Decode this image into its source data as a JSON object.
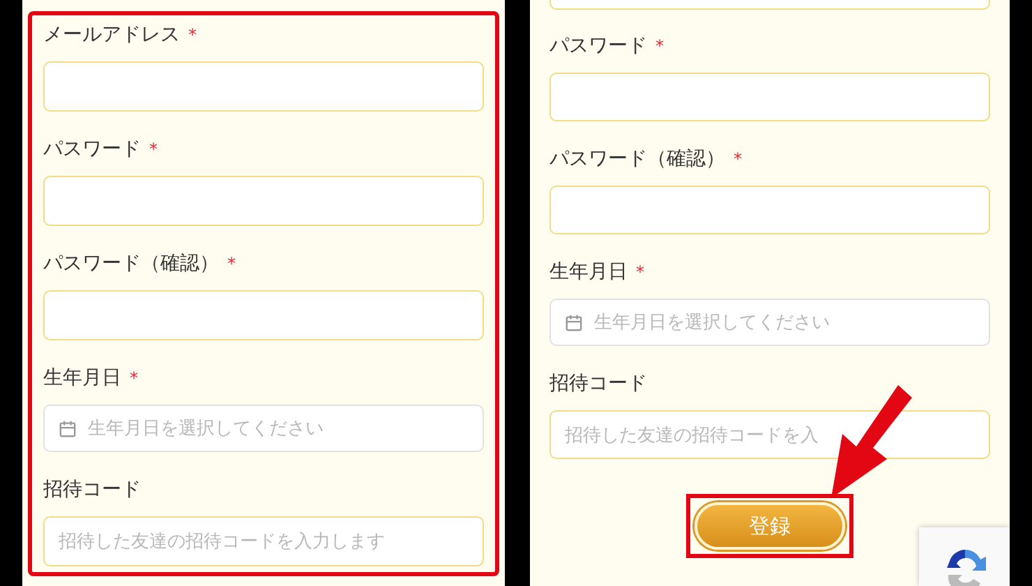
{
  "screens": [
    {
      "annotated": true,
      "fields": [
        {
          "label": "メールアドレス",
          "mark": "*",
          "kind": "text"
        },
        {
          "label": "パスワード",
          "mark": "*",
          "kind": "text"
        },
        {
          "label": "パスワード（確認）",
          "mark": "*",
          "kind": "text"
        },
        {
          "label": "生年月日",
          "mark": "*",
          "kind": "date",
          "placeholder": "生年月日を選択してください"
        },
        {
          "label": "招待コード",
          "kind": "text",
          "placeholder": "招待した友達の招待コードを入力します"
        }
      ]
    },
    {
      "cut_top_field": true,
      "fields": [
        {
          "label": "パスワード",
          "mark": "*",
          "kind": "text"
        },
        {
          "label": "パスワード（確認）",
          "mark": "*",
          "kind": "text"
        },
        {
          "label": "生年月日",
          "mark": "*",
          "kind": "date",
          "placeholder": "生年月日を選択してください"
        },
        {
          "label": "招待コード",
          "kind": "text",
          "placeholder": "招待した友達の招待コードを入"
        }
      ],
      "submit": {
        "label": "登録",
        "annotated": true
      },
      "arrow": true,
      "recaptcha": true
    }
  ]
}
